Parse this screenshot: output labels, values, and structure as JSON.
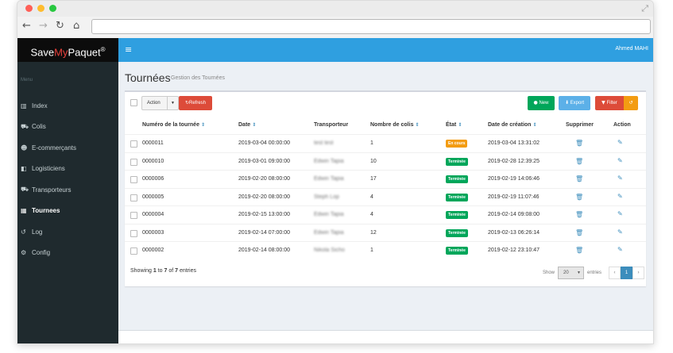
{
  "app": {
    "brand_prefix": "Save",
    "brand_accent": "My",
    "brand_suffix": "Paquet",
    "brand_mark": "®"
  },
  "header": {
    "user": "Ahmed MAHI",
    "accent_color": "#2f9fe0"
  },
  "sidebar": {
    "menu_label": "Menu",
    "items": [
      {
        "label": "Index",
        "icon": "bar-chart-icon",
        "glyph": "▥"
      },
      {
        "label": "Colis",
        "icon": "truck-icon",
        "glyph": "⛟"
      },
      {
        "label": "E-commerçants",
        "icon": "users-icon",
        "glyph": "☻"
      },
      {
        "label": "Logisticiens",
        "icon": "cube-icon",
        "glyph": "◧"
      },
      {
        "label": "Transporteurs",
        "icon": "truck-icon",
        "glyph": "⛟"
      },
      {
        "label": "Tournees",
        "icon": "map-icon",
        "glyph": "▦"
      },
      {
        "label": "Log",
        "icon": "history-icon",
        "glyph": "↺"
      },
      {
        "label": "Config",
        "icon": "cogs-icon",
        "glyph": "⚙"
      }
    ]
  },
  "page": {
    "title": "Tournées",
    "subtitle": "Gestion des Tournées"
  },
  "toolbar": {
    "action_label": "Action",
    "refresh_label": "Refresh",
    "new_label": "New",
    "export_label": "Export",
    "filter_label": "Filter"
  },
  "table": {
    "columns": [
      "Numéro de la tournée",
      "Date",
      "Transporteur",
      "Nombre de colis",
      "État",
      "Date de création",
      "Supprimer",
      "Action"
    ],
    "rows": [
      {
        "numero": "0000011",
        "date": "2019-03-04 00:00:00",
        "transporteur": "test test",
        "colis": "1",
        "etat": "En cours",
        "etat_color": "#f39c12",
        "creation": "2019-03-04 13:31:02"
      },
      {
        "numero": "0000010",
        "date": "2019-03-01 09:00:00",
        "transporteur": "Edwin Tapia",
        "colis": "10",
        "etat": "Terminée",
        "etat_color": "#00a65a",
        "creation": "2019-02-28 12:39:25"
      },
      {
        "numero": "0000006",
        "date": "2019-02-20 08:00:00",
        "transporteur": "Edwin Tapia",
        "colis": "17",
        "etat": "Terminée",
        "etat_color": "#00a65a",
        "creation": "2019-02-19 14:06:46"
      },
      {
        "numero": "0000005",
        "date": "2019-02-20 08:00:00",
        "transporteur": "Steph Lop",
        "colis": "4",
        "etat": "Terminée",
        "etat_color": "#00a65a",
        "creation": "2019-02-19 11:07:46"
      },
      {
        "numero": "0000004",
        "date": "2019-02-15 13:00:00",
        "transporteur": "Edwin Tapia",
        "colis": "4",
        "etat": "Terminée",
        "etat_color": "#00a65a",
        "creation": "2019-02-14 09:08:00"
      },
      {
        "numero": "0000003",
        "date": "2019-02-14 07:00:00",
        "transporteur": "Edwin Tapia",
        "colis": "12",
        "etat": "Terminée",
        "etat_color": "#00a65a",
        "creation": "2019-02-13 06:26:14"
      },
      {
        "numero": "0000002",
        "date": "2019-02-14 08:00:00",
        "transporteur": "Nikola Sicho",
        "colis": "1",
        "etat": "Terminée",
        "etat_color": "#00a65a",
        "creation": "2019-02-12 23:10:47"
      }
    ]
  },
  "footer": {
    "info_prefix": "Showing",
    "info_from": "1",
    "info_to_word": "to",
    "info_to": "7",
    "info_of_word": "of",
    "info_total": "7",
    "info_suffix": "entries",
    "show_label": "Show",
    "page_length": "20",
    "entries_label": "entries",
    "prev": "‹",
    "page": "1",
    "next": "›"
  }
}
